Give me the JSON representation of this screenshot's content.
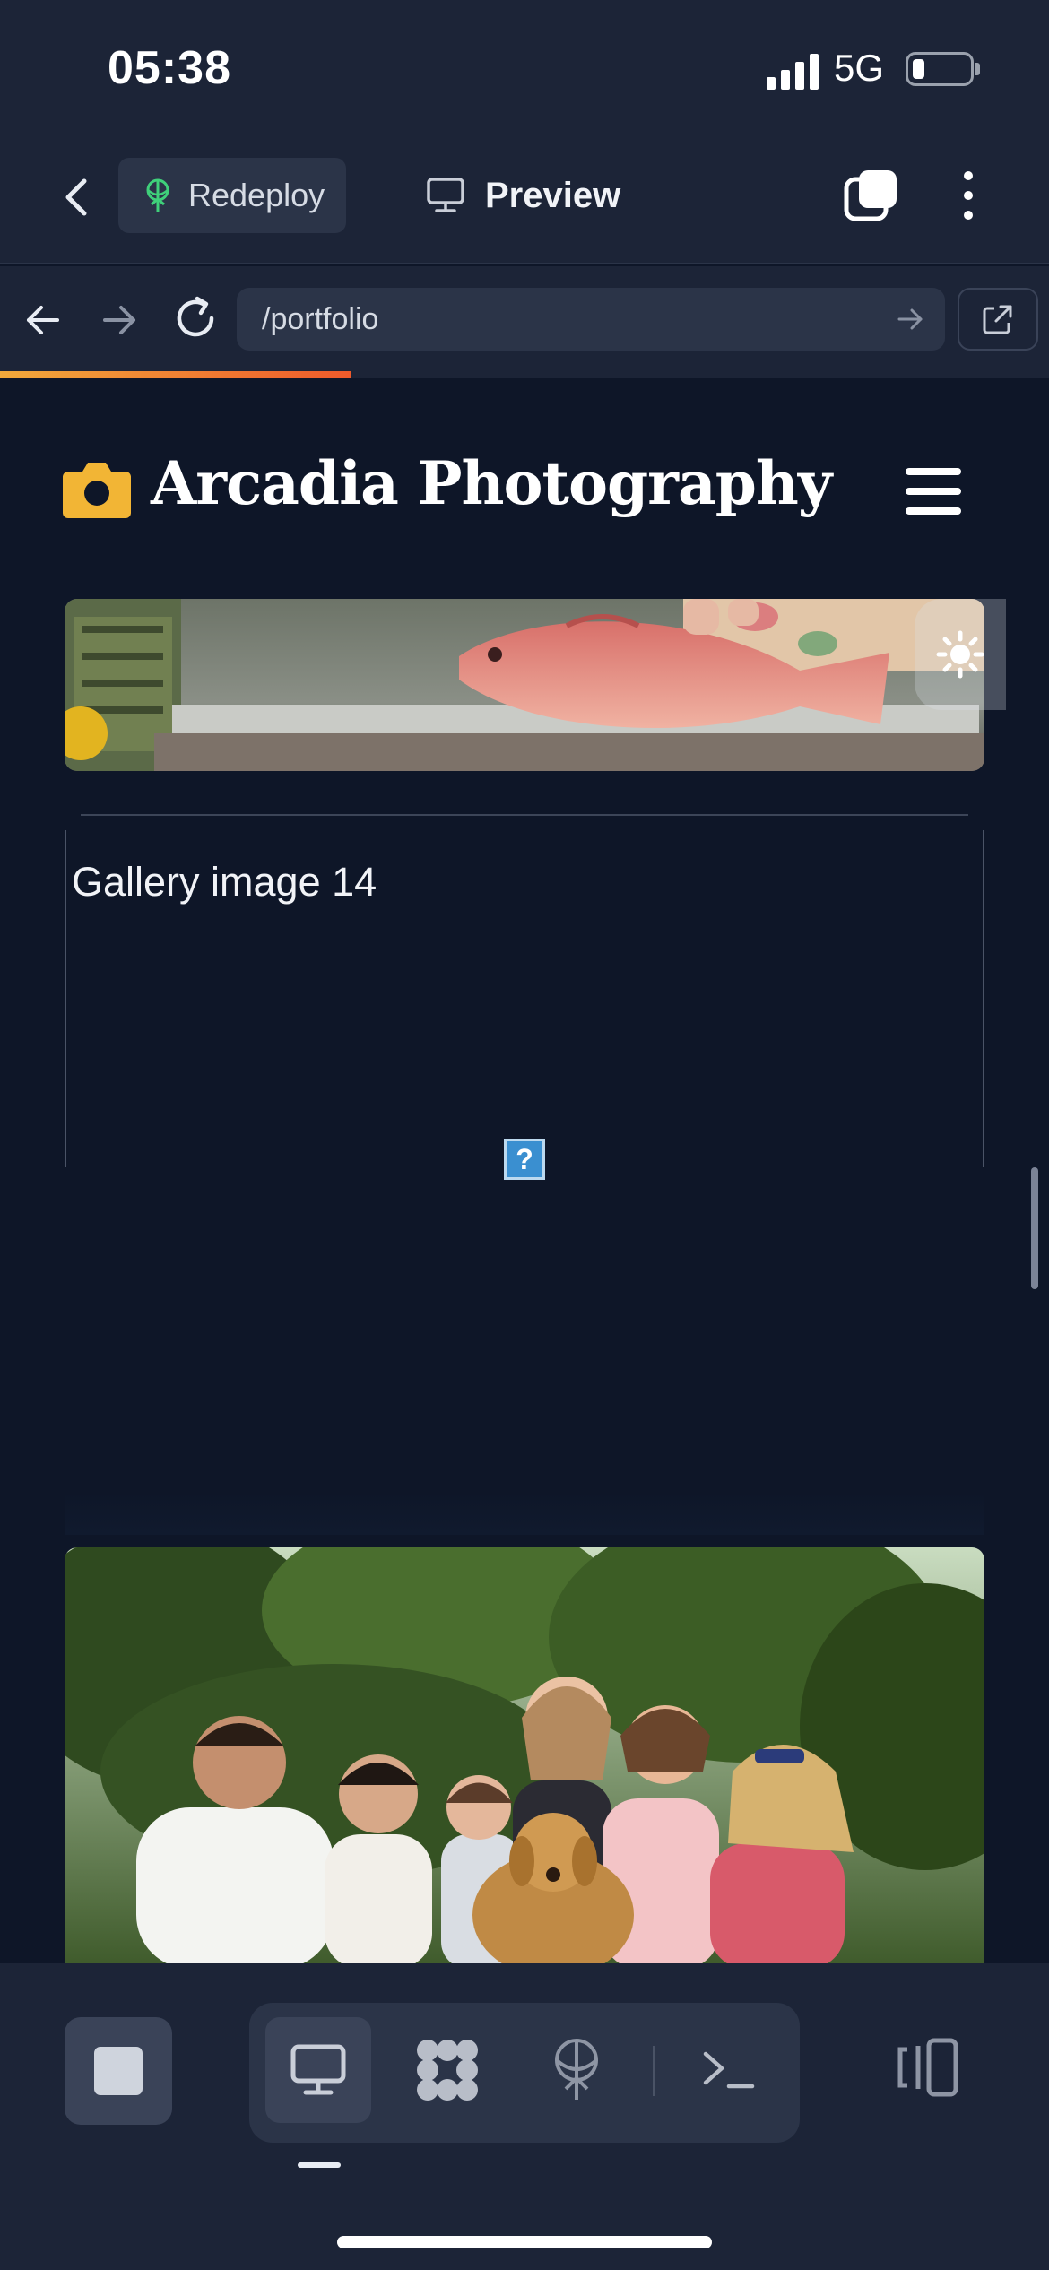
{
  "status_bar": {
    "time": "05:38",
    "network": "5G",
    "battery_level": 0.2
  },
  "app_header": {
    "back_icon": "chevron-left-icon",
    "redeploy_label": "Redeploy",
    "redeploy_icon": "deploy-tree-icon",
    "preview_label": "Preview",
    "preview_icon": "monitor-icon",
    "tabs_icon": "tabs-icon",
    "more_icon": "more-vertical-icon"
  },
  "url_bar": {
    "path": "/portfolio",
    "load_progress": 0.335
  },
  "site": {
    "title": "Arcadia Photography",
    "logo_icon": "camera-icon",
    "logo_color": "#f2b535",
    "menu_icon": "hamburger-icon"
  },
  "gallery": {
    "broken_image_alt": "Gallery image 14",
    "broken_image_glyph": "?"
  },
  "colors": {
    "background": "#0e1628",
    "chrome": "#1c2437",
    "accent_start": "#f2a93b",
    "accent_end": "#ee5a2b"
  }
}
